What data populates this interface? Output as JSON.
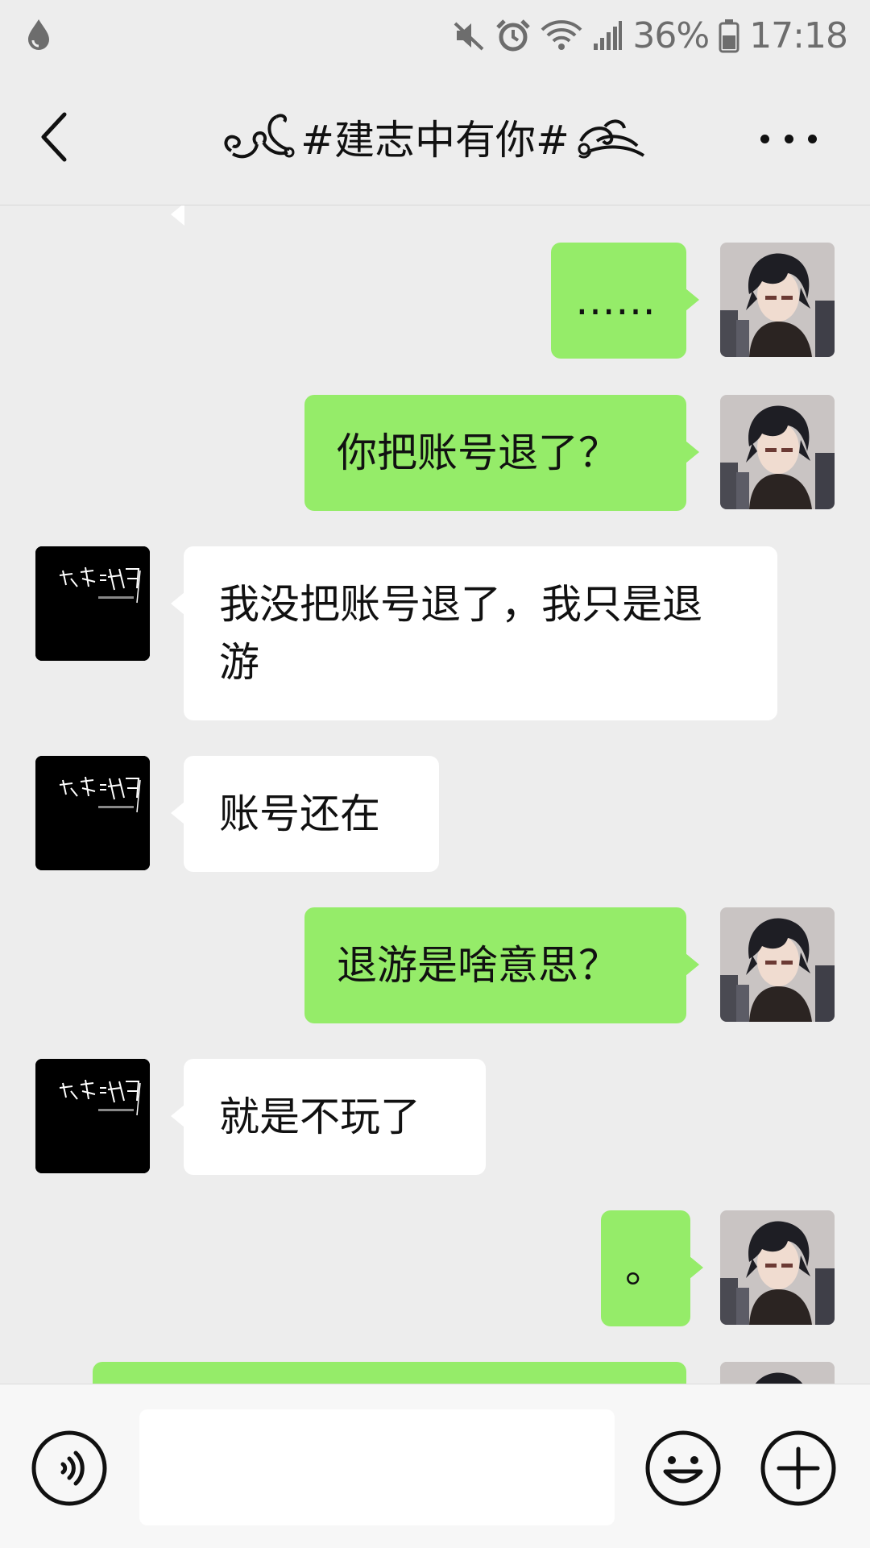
{
  "status_bar": {
    "battery": "36%",
    "time": "17:18",
    "icons": [
      "water-drop-icon",
      "mute-icon",
      "alarm-icon",
      "wifi-icon",
      "signal-icon",
      "battery-icon"
    ]
  },
  "header": {
    "title": "#建志中有你#",
    "back_icon": "back-chevron-icon",
    "more_icon": "more-dots-icon"
  },
  "messages": [
    {
      "from": "me",
      "text": "……"
    },
    {
      "from": "me",
      "text": "你把账号退了？"
    },
    {
      "from": "other",
      "text": "我没把账号退了，我只是退游"
    },
    {
      "from": "other",
      "text": "账号还在"
    },
    {
      "from": "me",
      "text": "退游是啥意思？"
    },
    {
      "from": "other",
      "text": "就是不玩了"
    },
    {
      "from": "me",
      "text": "。"
    }
  ],
  "colors": {
    "background": "#ededed",
    "my_bubble": "#95ec69",
    "their_bubble": "#ffffff",
    "input_bar": "#f7f7f7"
  },
  "input": {
    "value": "",
    "placeholder": "",
    "icons": [
      "voice-icon",
      "emoji-icon",
      "plus-icon"
    ]
  }
}
